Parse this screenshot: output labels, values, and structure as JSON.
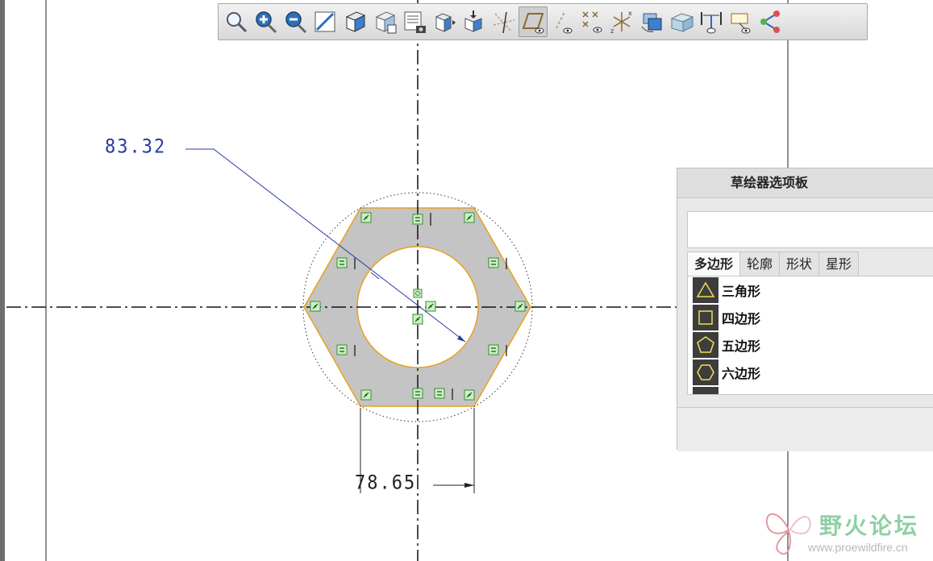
{
  "toolbar": {
    "buttons": [
      {
        "name": "zoom-refit",
        "icon": "magnifier-icon"
      },
      {
        "name": "zoom-in",
        "icon": "zoom-in-icon"
      },
      {
        "name": "zoom-out",
        "icon": "zoom-out-icon"
      },
      {
        "name": "repaint",
        "icon": "repaint-icon"
      },
      {
        "name": "display-style",
        "icon": "cube-shaded-icon"
      },
      {
        "name": "saved-orientations",
        "icon": "cube-orient-icon"
      },
      {
        "name": "view-manager",
        "icon": "view-manager-icon"
      },
      {
        "name": "appearance",
        "icon": "cube-appearance-icon"
      },
      {
        "name": "section",
        "icon": "cube-section-icon"
      },
      {
        "name": "datum-display",
        "icon": "datum-display-icon"
      },
      {
        "name": "sketch-view",
        "icon": "sketch-view-icon",
        "active": true
      },
      {
        "name": "dimension-display",
        "icon": "dimension-display-icon"
      },
      {
        "name": "constraint-display",
        "icon": "constraint-display-icon"
      },
      {
        "name": "grid-display",
        "icon": "grid-display-icon"
      },
      {
        "name": "vertex-display",
        "icon": "vertex-display-icon"
      },
      {
        "name": "spin-center",
        "icon": "spin-center-icon"
      },
      {
        "name": "annotation-display",
        "icon": "annotation-display-icon"
      },
      {
        "name": "note-display",
        "icon": "note-display-icon"
      },
      {
        "name": "sketch-tools",
        "icon": "sketch-tools-icon"
      }
    ]
  },
  "sketch": {
    "dim_diameter": "83.32",
    "dim_width": "78.65"
  },
  "palette": {
    "title": "草绘器选项板",
    "search_value": "",
    "tabs": [
      "多边形",
      "轮廓",
      "形状",
      "星形"
    ],
    "active_tab": 0,
    "items": [
      {
        "label": "三角形",
        "icon": "triangle-icon"
      },
      {
        "label": "四边形",
        "icon": "square-icon"
      },
      {
        "label": "五边形",
        "icon": "pentagon-icon"
      },
      {
        "label": "六边形",
        "icon": "hexagon-icon"
      }
    ]
  },
  "watermark": {
    "name": "野火论坛",
    "url": "www.proewildfire.cn"
  },
  "colors": {
    "fill": "#c4c4c4",
    "edge": "#e8a020",
    "dimension": "#2a3aa6",
    "constraint_bg": "#c9f2c0",
    "constraint_border": "#3c8a3a",
    "shape_icon_stroke": "#f0e050"
  }
}
